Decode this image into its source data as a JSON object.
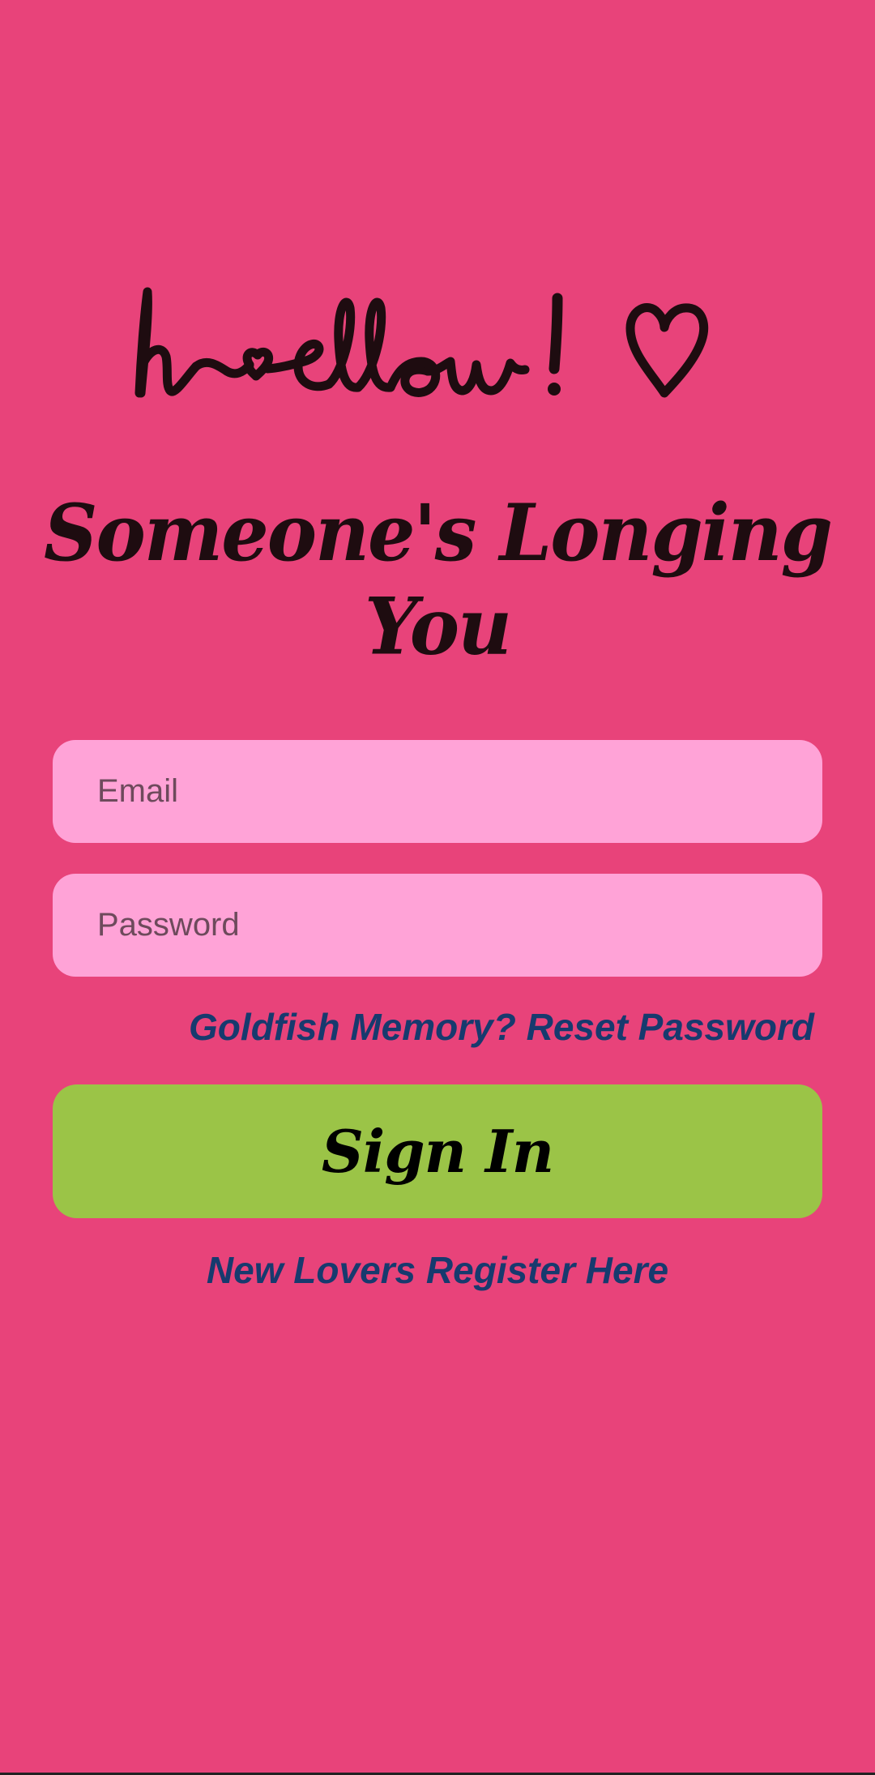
{
  "app": {
    "logo_text": "hellow! ♡",
    "tagline": "Someone's Longing You"
  },
  "form": {
    "email_placeholder": "Email",
    "password_placeholder": "Password",
    "reset_link": "Goldfish Memory? Reset Password",
    "signin_label": "Sign In",
    "register_link": "New Lovers Register Here"
  },
  "colors": {
    "background": "#e8437a",
    "field_background": "#ffa3d7",
    "button_background": "#9bc447",
    "link_color": "#173a6e",
    "heading_color": "#1e0c10"
  }
}
